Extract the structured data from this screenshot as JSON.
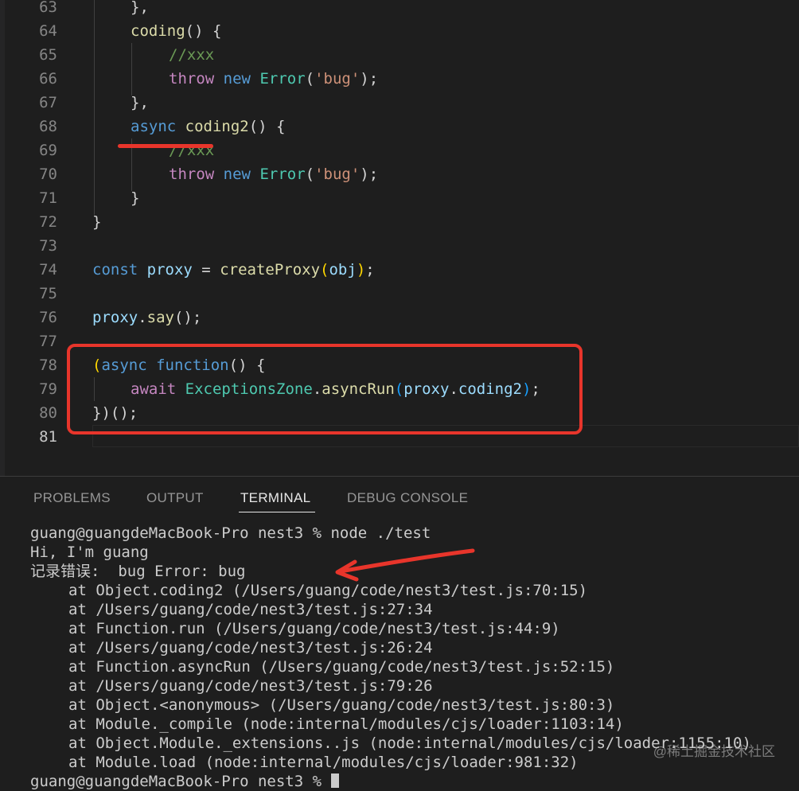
{
  "editor": {
    "lines": [
      {
        "n": "63",
        "tokens": [
          {
            "t": "},",
            "c": "t-pun"
          }
        ]
      },
      {
        "n": "64",
        "tokens": [
          {
            "t": "coding",
            "c": "t-fn"
          },
          {
            "t": "() {",
            "c": "t-pun"
          }
        ]
      },
      {
        "n": "65",
        "tokens": [
          {
            "t": "//xxx",
            "c": "t-cm"
          }
        ]
      },
      {
        "n": "66",
        "tokens": [
          {
            "t": "throw",
            "c": "t-kw"
          },
          {
            "t": " ",
            "c": "t-pun"
          },
          {
            "t": "new",
            "c": "t-kw2"
          },
          {
            "t": " ",
            "c": "t-pun"
          },
          {
            "t": "Error",
            "c": "t-cls"
          },
          {
            "t": "(",
            "c": "t-pun"
          },
          {
            "t": "'bug'",
            "c": "t-str"
          },
          {
            "t": ");",
            "c": "t-pun"
          }
        ]
      },
      {
        "n": "67",
        "tokens": [
          {
            "t": "},",
            "c": "t-pun"
          }
        ]
      },
      {
        "n": "68",
        "tokens": [
          {
            "t": "async",
            "c": "t-kw2"
          },
          {
            "t": " ",
            "c": "t-pun"
          },
          {
            "t": "coding2",
            "c": "t-fn"
          },
          {
            "t": "() {",
            "c": "t-pun"
          }
        ]
      },
      {
        "n": "69",
        "tokens": [
          {
            "t": "//xxx",
            "c": "t-cm"
          }
        ]
      },
      {
        "n": "70",
        "tokens": [
          {
            "t": "throw",
            "c": "t-kw"
          },
          {
            "t": " ",
            "c": "t-pun"
          },
          {
            "t": "new",
            "c": "t-kw2"
          },
          {
            "t": " ",
            "c": "t-pun"
          },
          {
            "t": "Error",
            "c": "t-cls"
          },
          {
            "t": "(",
            "c": "t-pun"
          },
          {
            "t": "'bug'",
            "c": "t-str"
          },
          {
            "t": ");",
            "c": "t-pun"
          }
        ]
      },
      {
        "n": "71",
        "tokens": [
          {
            "t": "}",
            "c": "t-pun"
          }
        ]
      },
      {
        "n": "72",
        "tokens": [
          {
            "t": "}",
            "c": "t-pun"
          }
        ]
      },
      {
        "n": "73",
        "tokens": []
      },
      {
        "n": "74",
        "tokens": [
          {
            "t": "const",
            "c": "t-kw2"
          },
          {
            "t": " ",
            "c": "t-pun"
          },
          {
            "t": "proxy",
            "c": "t-var"
          },
          {
            "t": " = ",
            "c": "t-pun"
          },
          {
            "t": "createProxy",
            "c": "t-fn"
          },
          {
            "t": "(",
            "c": "t-br1"
          },
          {
            "t": "obj",
            "c": "t-var"
          },
          {
            "t": ")",
            "c": "t-br1"
          },
          {
            "t": ";",
            "c": "t-pun"
          }
        ]
      },
      {
        "n": "75",
        "tokens": []
      },
      {
        "n": "76",
        "tokens": [
          {
            "t": "proxy",
            "c": "t-var"
          },
          {
            "t": ".",
            "c": "t-pun"
          },
          {
            "t": "say",
            "c": "t-fn"
          },
          {
            "t": "();",
            "c": "t-pun"
          }
        ]
      },
      {
        "n": "77",
        "tokens": []
      },
      {
        "n": "78",
        "tokens": [
          {
            "t": "(",
            "c": "t-br1"
          },
          {
            "t": "async",
            "c": "t-kw2"
          },
          {
            "t": " ",
            "c": "t-pun"
          },
          {
            "t": "function",
            "c": "t-kw2"
          },
          {
            "t": "() {",
            "c": "t-pun"
          }
        ]
      },
      {
        "n": "79",
        "tokens": [
          {
            "t": "await",
            "c": "t-kw"
          },
          {
            "t": " ",
            "c": "t-pun"
          },
          {
            "t": "ExceptionsZone",
            "c": "t-cls"
          },
          {
            "t": ".",
            "c": "t-pun"
          },
          {
            "t": "asyncRun",
            "c": "t-fn"
          },
          {
            "t": "(",
            "c": "t-br3"
          },
          {
            "t": "proxy",
            "c": "t-var"
          },
          {
            "t": ".",
            "c": "t-pun"
          },
          {
            "t": "coding2",
            "c": "t-var"
          },
          {
            "t": ")",
            "c": "t-br3"
          },
          {
            "t": ";",
            "c": "t-pun"
          }
        ]
      },
      {
        "n": "80",
        "tokens": [
          {
            "t": "})",
            "c": "t-pun"
          },
          {
            "t": "();",
            "c": "t-pun"
          }
        ]
      },
      {
        "n": "81",
        "tokens": []
      }
    ]
  },
  "panel": {
    "tabs": {
      "problems": "PROBLEMS",
      "output": "OUTPUT",
      "terminal": "TERMINAL",
      "debug_console": "DEBUG CONSOLE"
    },
    "terminal": {
      "prompt_command": "guang@guangdeMacBook-Pro nest3 % node ./test",
      "output_hi": "Hi, I'm guang",
      "error_line": "记录错误:  bug Error: bug",
      "stack": [
        "at Object.coding2 (/Users/guang/code/nest3/test.js:70:15)",
        "at /Users/guang/code/nest3/test.js:27:34",
        "at Function.run (/Users/guang/code/nest3/test.js:44:9)",
        "at /Users/guang/code/nest3/test.js:26:24",
        "at Function.asyncRun (/Users/guang/code/nest3/test.js:52:15)",
        "at /Users/guang/code/nest3/test.js:79:26",
        "at Object.<anonymous> (/Users/guang/code/nest3/test.js:80:3)",
        "at Module._compile (node:internal/modules/cjs/loader:1103:14)",
        "at Object.Module._extensions..js (node:internal/modules/cjs/loader:1155:10)",
        "at Module.load (node:internal/modules/cjs/loader:981:32)"
      ],
      "last_prompt": "guang@guangdeMacBook-Pro nest3 % "
    }
  },
  "watermark": "@稀土掘金技术社区",
  "colors": {
    "annotation_red": "#e8352b",
    "background": "#1e1e1e"
  }
}
